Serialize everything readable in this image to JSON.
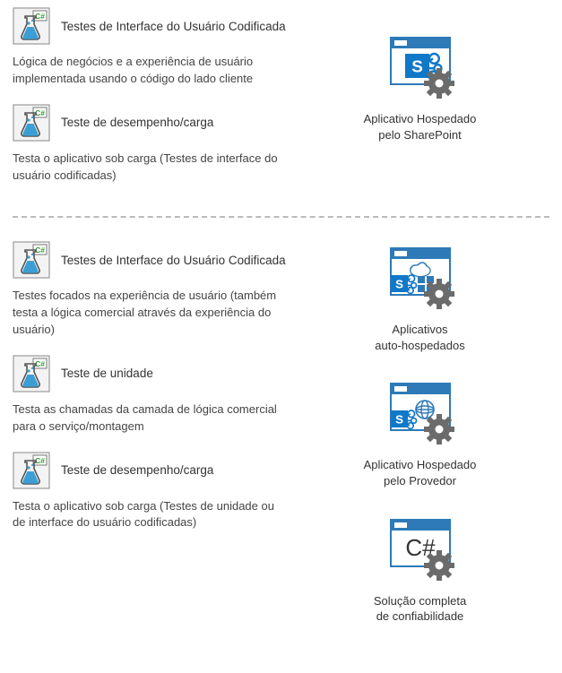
{
  "top": {
    "tests": [
      {
        "title": "Testes de Interface do Usuário Codificada",
        "desc": "Lógica de negócios e a experiência de usuário implementada usando o código do lado cliente"
      },
      {
        "title": "Teste de desempenho/carga",
        "desc": "Testa o aplicativo sob carga (Testes de interface do usuário codificadas)"
      }
    ],
    "app": {
      "caption_l1": "Aplicativo Hospedado",
      "caption_l2": "pelo SharePoint"
    }
  },
  "bottom": {
    "tests": [
      {
        "title": "Testes de Interface do Usuário Codificada",
        "desc": "Testes focados na experiência de usuário (também testa a lógica comercial através da experiência do usuário)"
      },
      {
        "title": "Teste de unidade",
        "desc": "Testa as chamadas da camada de lógica comercial para o serviço/montagem"
      },
      {
        "title": "Teste de desempenho/carga",
        "desc": "Testa o aplicativo sob carga (Testes de unidade ou de interface do usuário codificadas)"
      }
    ],
    "apps": [
      {
        "caption_l1": "Aplicativos",
        "caption_l2": "auto-hospedados"
      },
      {
        "caption_l1": "Aplicativo Hospedado",
        "caption_l2": "pelo Provedor"
      },
      {
        "caption_l1": "Solução completa",
        "caption_l2": "de confiabilidade"
      }
    ]
  }
}
